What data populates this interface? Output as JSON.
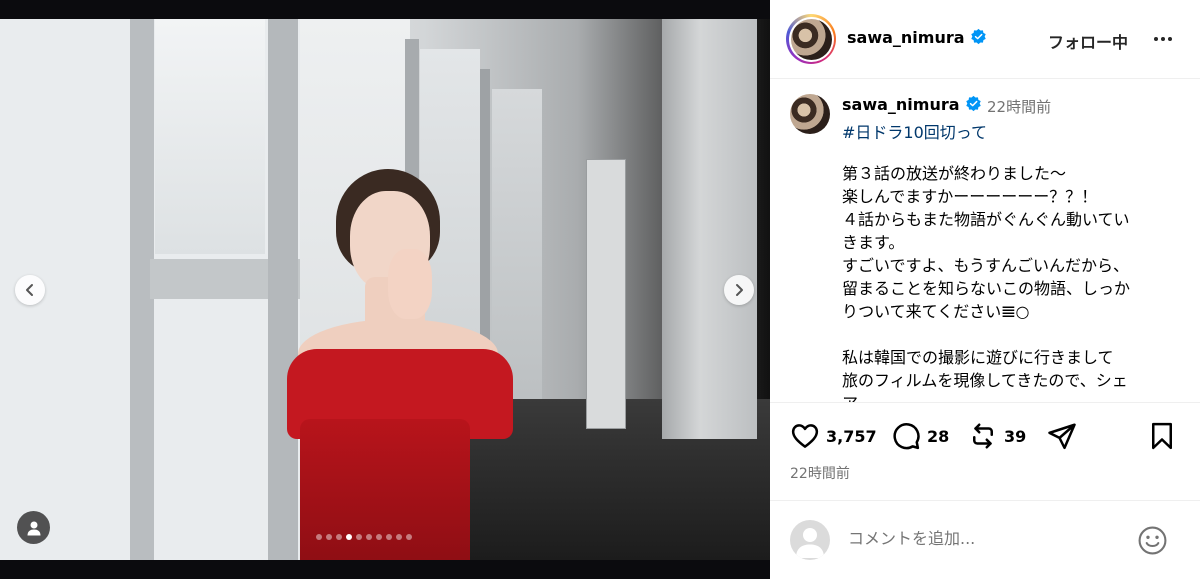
{
  "post": {
    "username": "sawa_nimura",
    "follow_label": "フォロー中",
    "caption_time": "22時間前",
    "hashtag": "#日ドラ10回切って",
    "caption_lines": [
      "第３話の放送が終わりました〜",
      "楽しんでますかーーーーーー？？！",
      "４話からもまた物語がぐんぐん動いてい",
      "きます。",
      "すごいですよ、もうすんごいんだから、",
      "留まることを知らないこの物語、しっか",
      "りついて来てください𝌆○",
      "",
      "私は韓国での撮影に遊びに行きまして",
      "旅のフィルムを現像してきたので、シェ",
      "ア。"
    ],
    "likes": "3,757",
    "comments": "28",
    "reposts": "39",
    "post_time": "22時間前",
    "comment_placeholder": "コメントを追加..."
  },
  "carousel": {
    "slide_count": 10,
    "active_index": 3
  },
  "icons": {
    "verified": "verified-badge-icon",
    "like": "heart-icon",
    "comment": "comment-icon",
    "repost": "repost-icon",
    "share": "paper-plane-icon",
    "save": "bookmark-icon",
    "emoji": "emoji-icon",
    "more": "more-dots-icon",
    "prev": "chevron-left-icon",
    "next": "chevron-right-icon",
    "tag": "user-tag-icon"
  },
  "colors": {
    "verified": "#0095f6",
    "hashtag": "#00376b",
    "muted": "#737373"
  }
}
